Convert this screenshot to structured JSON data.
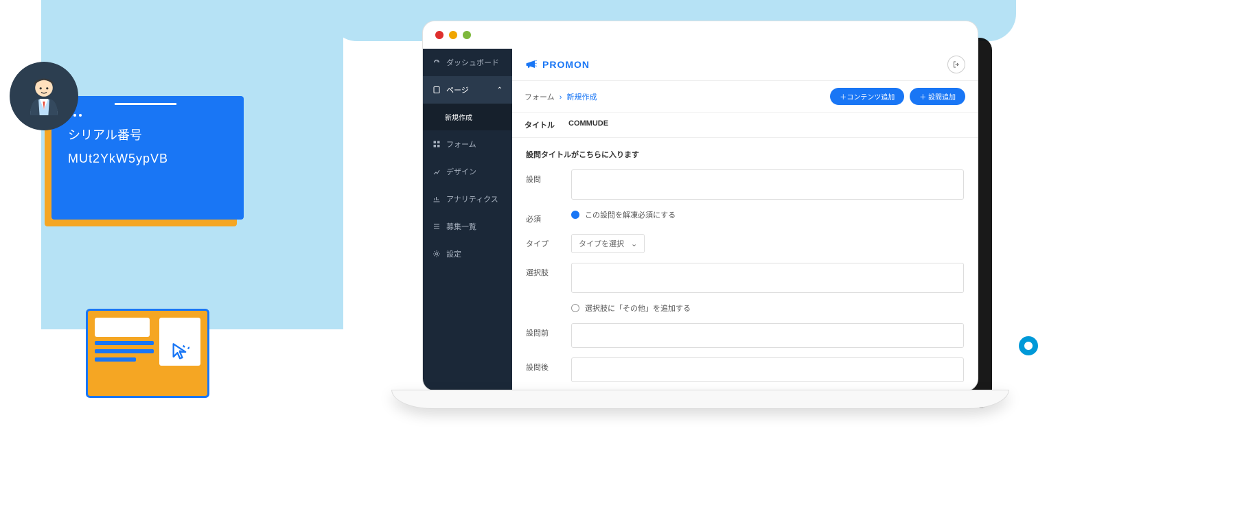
{
  "serial_card": {
    "label": "シリアル番号",
    "value": "MUt2YkW5ypVB"
  },
  "brand": {
    "name": "PROMON"
  },
  "sidebar": {
    "items": [
      {
        "label": "ダッシュボード",
        "icon": "gauge-icon"
      },
      {
        "label": "ページ",
        "icon": "page-icon",
        "expanded": true
      },
      {
        "label": "新規作成",
        "sub": true
      },
      {
        "label": "フォーム",
        "icon": "grid-icon"
      },
      {
        "label": "デザイン",
        "icon": "design-icon"
      },
      {
        "label": "アナリティクス",
        "icon": "chart-icon"
      },
      {
        "label": "募集一覧",
        "icon": "list-icon"
      },
      {
        "label": "設定",
        "icon": "gear-icon"
      }
    ]
  },
  "breadcrumb": {
    "root": "フォーム",
    "current": "新規作成"
  },
  "actions": {
    "add_content": "＋コンテンツ追加",
    "add_question": "＋ 設問追加"
  },
  "tabs": [
    "タイトル",
    "COMMUDE"
  ],
  "form": {
    "title": "設問タイトルがこちらに入ります",
    "question_label": "設問",
    "required_label": "必須",
    "required_text": "この設問を解凍必須にする",
    "type_label": "タイプ",
    "type_placeholder": "タイプを選択",
    "options_label": "選択肢",
    "options_other_text": "選択肢に「その他」を追加する",
    "before_label": "設問前",
    "after_label": "設問後"
  }
}
